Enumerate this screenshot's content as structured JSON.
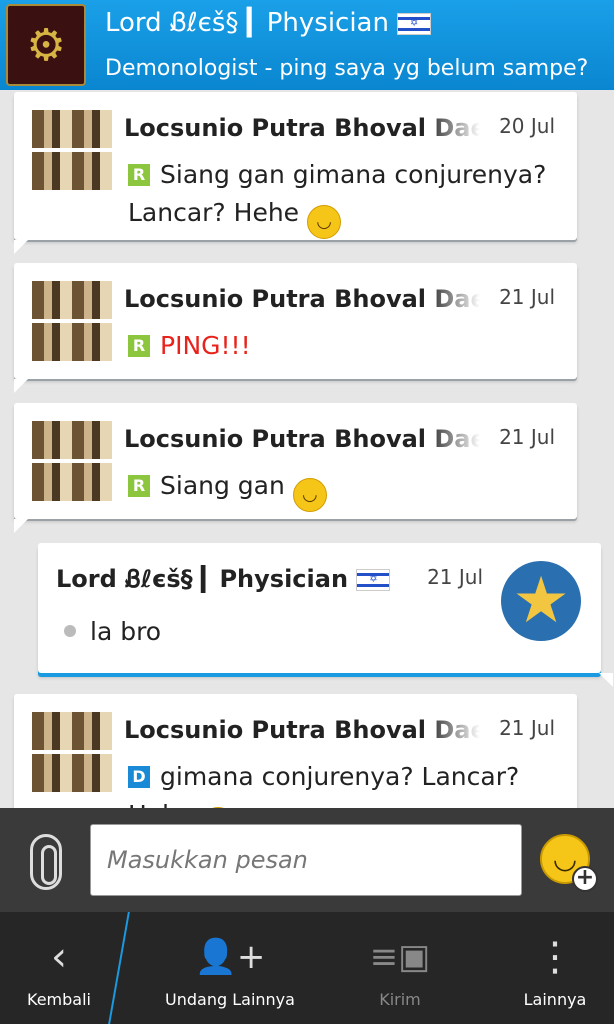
{
  "header": {
    "title": "Lord Ᏸℓєš§ ▎Physician",
    "status": "Demonologist - ping saya yg belum sampe?"
  },
  "messages": [
    {
      "sender": "Locsunio Putra Bhoval Daemon",
      "date": "20 Jul",
      "badge": "R",
      "text": "Siang gan gimana conjurenya? Lancar? Hehe",
      "emoji": "smile"
    },
    {
      "sender": "Locsunio Putra Bhoval Daemon",
      "date": "21 Jul",
      "badge": "R",
      "text": "PING!!!"
    },
    {
      "sender": "Locsunio Putra Bhoval Daemon",
      "date": "21 Jul",
      "badge": "R",
      "text": "Siang gan",
      "emoji": "grin"
    },
    {
      "sender": "Lord Ᏸℓєš§ ▎Physician",
      "date": "21 Jul",
      "text": "la bro"
    },
    {
      "sender": "Locsunio Putra Bhoval Daemon",
      "date": "21 Jul",
      "badge": "D",
      "text": "gimana conjurenya? Lancar? Hehe",
      "emoji": "smile"
    }
  ],
  "compose": {
    "placeholder": "Masukkan pesan"
  },
  "actions": {
    "back": "Kembali",
    "invite": "Undang Lainnya",
    "send": "Kirim",
    "more": "Lainnya"
  },
  "colors": {
    "header": "#0a86d0",
    "badge_read": "#8cc63e",
    "badge_delivered": "#1a8ad6",
    "ping": "#e8231b"
  }
}
